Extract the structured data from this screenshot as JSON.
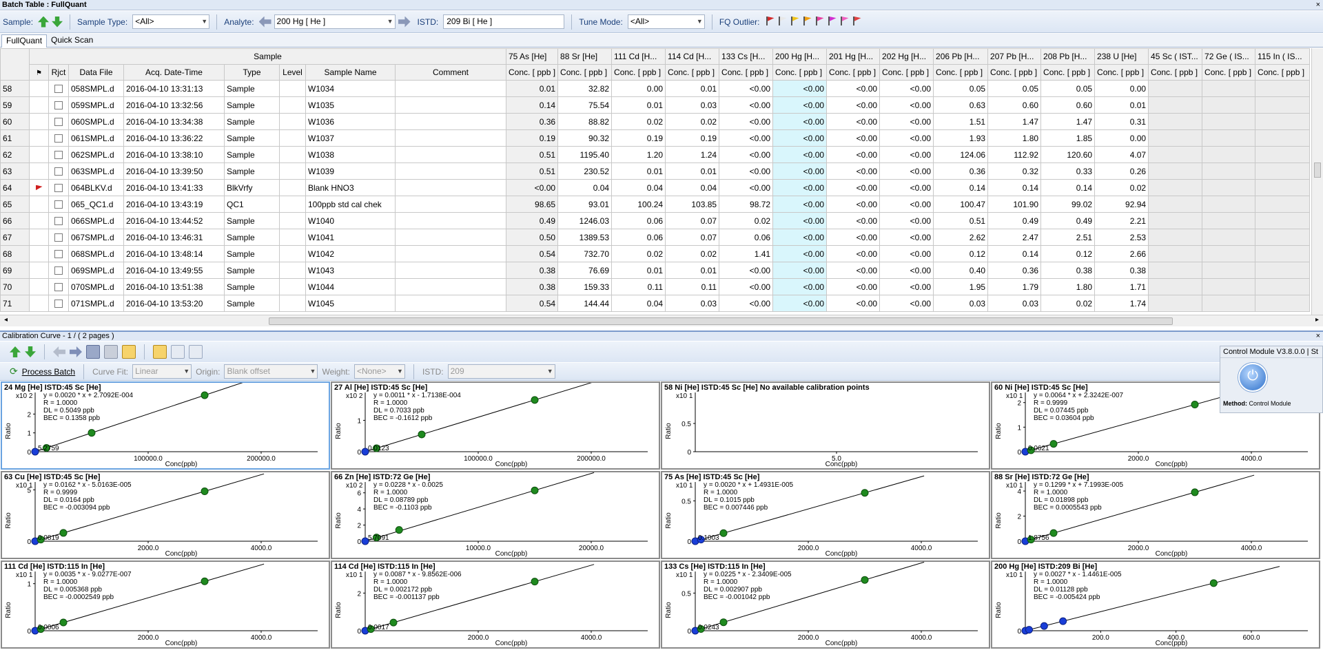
{
  "window": {
    "title": "Batch Table : FullQuant",
    "close": "×"
  },
  "toolbar": {
    "sample_label": "Sample:",
    "sample_type_label": "Sample Type:",
    "sample_type_value": "<All>",
    "analyte_label": "Analyte:",
    "analyte_value": "200  Hg  [ He ]",
    "istd_label": "ISTD:",
    "istd_value": "209  Bi  [ He ]",
    "tune_mode_label": "Tune Mode:",
    "tune_mode_value": "<All>",
    "fq_outlier_label": "FQ Outlier:",
    "flag_colors": [
      "#d42a2a",
      "#e8e8e8",
      "#f0c419",
      "#f0a010",
      "#e83fa0",
      "#d02fd0",
      "#f060c0",
      "#e04040"
    ]
  },
  "tabs": [
    "FullQuant",
    "Quick Scan"
  ],
  "grid": {
    "group_header": "Sample",
    "columns": [
      "",
      "Rjct",
      "Data File",
      "Acq. Date-Time",
      "Type",
      "Level",
      "Sample Name",
      "Comment"
    ],
    "analytes": [
      "75  As  [He]",
      "88  Sr  [He]",
      "111  Cd  [H...",
      "114  Cd  [H...",
      "133  Cs  [H...",
      "200  Hg  [H...",
      "201  Hg  [H...",
      "202  Hg  [H...",
      "206  Pb  [H...",
      "207  Pb  [H...",
      "208  Pb  [H...",
      "238  U  [He]",
      "45  Sc  ( IST...",
      "72  Ge  ( IS...",
      "115  In  ( IS..."
    ],
    "unit": "Conc. [ ppb ]",
    "rows": [
      {
        "n": "58",
        "flag": false,
        "file": "058SMPL.d",
        "dt": "2016-04-10 13:31:13",
        "type": "Sample",
        "level": "",
        "name": "W1034",
        "comment": "",
        "vals": [
          "0.01",
          "32.82",
          "0.00",
          "0.01",
          "<0.00",
          "<0.00",
          "<0.00",
          "<0.00",
          "0.05",
          "0.05",
          "0.05",
          "0.00",
          "",
          "",
          ""
        ]
      },
      {
        "n": "59",
        "flag": false,
        "file": "059SMPL.d",
        "dt": "2016-04-10 13:32:56",
        "type": "Sample",
        "level": "",
        "name": "W1035",
        "comment": "",
        "vals": [
          "0.14",
          "75.54",
          "0.01",
          "0.03",
          "<0.00",
          "<0.00",
          "<0.00",
          "<0.00",
          "0.63",
          "0.60",
          "0.60",
          "0.01",
          "",
          "",
          ""
        ]
      },
      {
        "n": "60",
        "flag": false,
        "file": "060SMPL.d",
        "dt": "2016-04-10 13:34:38",
        "type": "Sample",
        "level": "",
        "name": "W1036",
        "comment": "",
        "vals": [
          "0.36",
          "88.82",
          "0.02",
          "0.02",
          "<0.00",
          "<0.00",
          "<0.00",
          "<0.00",
          "1.51",
          "1.47",
          "1.47",
          "0.31",
          "",
          "",
          ""
        ]
      },
      {
        "n": "61",
        "flag": false,
        "file": "061SMPL.d",
        "dt": "2016-04-10 13:36:22",
        "type": "Sample",
        "level": "",
        "name": "W1037",
        "comment": "",
        "vals": [
          "0.19",
          "90.32",
          "0.19",
          "0.19",
          "<0.00",
          "<0.00",
          "<0.00",
          "<0.00",
          "1.93",
          "1.80",
          "1.85",
          "0.00",
          "",
          "",
          ""
        ]
      },
      {
        "n": "62",
        "flag": false,
        "file": "062SMPL.d",
        "dt": "2016-04-10 13:38:10",
        "type": "Sample",
        "level": "",
        "name": "W1038",
        "comment": "",
        "vals": [
          "0.51",
          "1195.40",
          "1.20",
          "1.24",
          "<0.00",
          "<0.00",
          "<0.00",
          "<0.00",
          "124.06",
          "112.92",
          "120.60",
          "4.07",
          "",
          "",
          ""
        ]
      },
      {
        "n": "63",
        "flag": false,
        "file": "063SMPL.d",
        "dt": "2016-04-10 13:39:50",
        "type": "Sample",
        "level": "",
        "name": "W1039",
        "comment": "",
        "vals": [
          "0.51",
          "230.52",
          "0.01",
          "0.01",
          "<0.00",
          "<0.00",
          "<0.00",
          "<0.00",
          "0.36",
          "0.32",
          "0.33",
          "0.26",
          "",
          "",
          ""
        ]
      },
      {
        "n": "64",
        "flag": true,
        "file": "064BLKV.d",
        "dt": "2016-04-10 13:41:33",
        "type": "BlkVrfy",
        "level": "",
        "name": "Blank HNO3",
        "comment": "",
        "vals": [
          "<0.00",
          "0.04",
          "0.04",
          "0.04",
          "<0.00",
          "<0.00",
          "<0.00",
          "<0.00",
          "0.14",
          "0.14",
          "0.14",
          "0.02",
          "",
          "",
          ""
        ]
      },
      {
        "n": "65",
        "flag": false,
        "file": "065_QC1.d",
        "dt": "2016-04-10 13:43:19",
        "type": "QC1",
        "level": "",
        "name": "100ppb std cal chek",
        "comment": "",
        "vals": [
          "98.65",
          "93.01",
          "100.24",
          "103.85",
          "98.72",
          "<0.00",
          "<0.00",
          "<0.00",
          "100.47",
          "101.90",
          "99.02",
          "92.94",
          "",
          "",
          ""
        ]
      },
      {
        "n": "66",
        "flag": false,
        "file": "066SMPL.d",
        "dt": "2016-04-10 13:44:52",
        "type": "Sample",
        "level": "",
        "name": "W1040",
        "comment": "",
        "vals": [
          "0.49",
          "1246.03",
          "0.06",
          "0.07",
          "0.02",
          "<0.00",
          "<0.00",
          "<0.00",
          "0.51",
          "0.49",
          "0.49",
          "2.21",
          "",
          "",
          ""
        ]
      },
      {
        "n": "67",
        "flag": false,
        "file": "067SMPL.d",
        "dt": "2016-04-10 13:46:31",
        "type": "Sample",
        "level": "",
        "name": "W1041",
        "comment": "",
        "vals": [
          "0.50",
          "1389.53",
          "0.06",
          "0.07",
          "0.06",
          "<0.00",
          "<0.00",
          "<0.00",
          "2.62",
          "2.47",
          "2.51",
          "2.53",
          "",
          "",
          ""
        ]
      },
      {
        "n": "68",
        "flag": false,
        "file": "068SMPL.d",
        "dt": "2016-04-10 13:48:14",
        "type": "Sample",
        "level": "",
        "name": "W1042",
        "comment": "",
        "vals": [
          "0.54",
          "732.70",
          "0.02",
          "0.02",
          "1.41",
          "<0.00",
          "<0.00",
          "<0.00",
          "0.12",
          "0.14",
          "0.12",
          "2.66",
          "",
          "",
          ""
        ]
      },
      {
        "n": "69",
        "flag": false,
        "file": "069SMPL.d",
        "dt": "2016-04-10 13:49:55",
        "type": "Sample",
        "level": "",
        "name": "W1043",
        "comment": "",
        "vals": [
          "0.38",
          "76.69",
          "0.01",
          "0.01",
          "<0.00",
          "<0.00",
          "<0.00",
          "<0.00",
          "0.40",
          "0.36",
          "0.38",
          "0.38",
          "",
          "",
          ""
        ]
      },
      {
        "n": "70",
        "flag": false,
        "file": "070SMPL.d",
        "dt": "2016-04-10 13:51:38",
        "type": "Sample",
        "level": "",
        "name": "W1044",
        "comment": "",
        "vals": [
          "0.38",
          "159.33",
          "0.11",
          "0.11",
          "<0.00",
          "<0.00",
          "<0.00",
          "<0.00",
          "1.95",
          "1.79",
          "1.80",
          "1.71",
          "",
          "",
          ""
        ]
      },
      {
        "n": "71",
        "flag": false,
        "file": "071SMPL.d",
        "dt": "2016-04-10 13:53:20",
        "type": "Sample",
        "level": "",
        "name": "W1045",
        "comment": "",
        "vals": [
          "0.54",
          "144.44",
          "0.04",
          "0.03",
          "<0.00",
          "<0.00",
          "<0.00",
          "<0.00",
          "0.03",
          "0.03",
          "0.02",
          "1.74",
          "",
          "",
          ""
        ]
      }
    ]
  },
  "calibration": {
    "header": "Calibration Curve -  1 / ( 2 pages )",
    "process_batch": "Process Batch",
    "curve_fit_label": "Curve Fit:",
    "curve_fit_value": "Linear",
    "origin_label": "Origin:",
    "origin_value": "Blank offset",
    "weight_label": "Weight:",
    "weight_value": "<None>",
    "istd_label": "ISTD:",
    "istd_value": "209",
    "xlabel": "Conc(ppb)",
    "ylabel": "Ratio"
  },
  "control_module": {
    "title": "Control Module V3.8.0.0 | St",
    "method_label": "Method:",
    "method_value": "Control Module"
  },
  "chart_data": [
    {
      "type": "scatter",
      "title": "24 Mg [He] ISTD:45 Sc [He]",
      "equation": "y = 0.0020 * x  + 2.7092E-004",
      "r": "R = 1.0000",
      "dl": "DL = 0.5049 ppb",
      "bec": "BEC = 0.1358 ppb",
      "yexp": "x10 2",
      "xticks": [
        "100000.0",
        "200000.0"
      ],
      "xmax": 250000,
      "ymax": 3,
      "yticks": [
        "0",
        "1",
        "2"
      ],
      "x": [
        0,
        10000,
        50000,
        150000
      ],
      "y": [
        0,
        0.2,
        1.0,
        3.0
      ],
      "low_label": "5.2759"
    },
    {
      "type": "scatter",
      "title": "27 Al [He] ISTD:45 Sc [He]",
      "equation": "y = 0.0011 * x  - 1.7138E-004",
      "r": "R = 1.0000",
      "dl": "DL = 0.7033 ppb",
      "bec": "BEC = -0.1612 ppb",
      "yexp": "x10 2",
      "xticks": [
        "100000.0",
        "200000.0"
      ],
      "xmax": 250000,
      "ymax": 1.8,
      "yticks": [
        "0",
        "1"
      ],
      "x": [
        0,
        10000,
        50000,
        150000
      ],
      "y": [
        0,
        0.11,
        0.55,
        1.65
      ],
      "low_label": "0.0123"
    },
    {
      "type": "scatter",
      "title": "58 Ni [He] ISTD:45 Sc [He] No available calibration points",
      "equation": "",
      "r": "",
      "dl": "",
      "bec": "",
      "yexp": "x10 1",
      "xticks": [
        "5.0"
      ],
      "xmax": 10,
      "ymax": 1,
      "yticks": [
        "0",
        "0.5"
      ],
      "x": [],
      "y": [],
      "low_label": ""
    },
    {
      "type": "scatter",
      "title": "60 Ni [He] ISTD:45 Sc [He]",
      "equation": "y = 0.0064 * x  + 2.3242E-007",
      "r": "R = 0.9999",
      "dl": "DL = 0.07445 ppb",
      "bec": "BEC = 0.03604 ppb",
      "yexp": "x10 1",
      "xticks": [
        "2000.0",
        "4000.0"
      ],
      "xmax": 5000,
      "ymax": 2.3,
      "yticks": [
        "0",
        "1",
        "2"
      ],
      "x": [
        0,
        100,
        500,
        3000
      ],
      "y": [
        0,
        0.06,
        0.32,
        1.92
      ],
      "low_label": "0.0621"
    },
    {
      "type": "scatter",
      "title": "63 Cu [He] ISTD:45 Sc [He]",
      "equation": "y = 0.0162 * x  - 5.0163E-005",
      "r": "R = 0.9999",
      "dl": "DL = 0.0164 ppb",
      "bec": "BEC = -0.003094 ppb",
      "yexp": "x10 1",
      "xticks": [
        "2000.0",
        "4000.0"
      ],
      "xmax": 5000,
      "ymax": 5.5,
      "yticks": [
        "0",
        "5"
      ],
      "x": [
        0,
        100,
        500,
        3000
      ],
      "y": [
        0,
        0.16,
        0.81,
        4.86
      ],
      "low_label": "0.0819"
    },
    {
      "type": "scatter",
      "title": "66 Zn [He] ISTD:72 Ge [He]",
      "equation": "y = 0.0228 * x  - 0.0025",
      "r": "R = 1.0000",
      "dl": "DL = 0.08789 ppb",
      "bec": "BEC = -0.1103 ppb",
      "yexp": "x10 2",
      "xticks": [
        "10000.0",
        "20000.0"
      ],
      "xmax": 25000,
      "ymax": 7,
      "yticks": [
        "0",
        "2",
        "4",
        "6"
      ],
      "x": [
        0,
        1000,
        3000,
        15000
      ],
      "y": [
        0,
        0.46,
        1.4,
        6.3
      ],
      "low_label": "5.7091"
    },
    {
      "type": "scatter",
      "title": "75 As [He] ISTD:45 Sc [He]",
      "equation": "y = 0.0020 * x  + 1.4931E-005",
      "r": "R = 1.0000",
      "dl": "DL = 0.1015 ppb",
      "bec": "BEC = 0.007446 ppb",
      "yexp": "x10 1",
      "xticks": [
        "2000.0",
        "4000.0"
      ],
      "xmax": 5000,
      "ymax": 0.7,
      "yticks": [
        "0",
        "0.5"
      ],
      "x": [
        0,
        100,
        500,
        3000
      ],
      "y": [
        0,
        0.02,
        0.1,
        0.6
      ],
      "low_label": "0.1003"
    },
    {
      "type": "scatter",
      "title": "88 Sr [He] ISTD:72 Ge [He]",
      "equation": "y = 0.1299 * x  + 7.1993E-005",
      "r": "R = 1.0000",
      "dl": "DL = 0.01898 ppb",
      "bec": "BEC = 0.0005543 ppb",
      "yexp": "x10 1",
      "xticks": [
        "2000.0",
        "4000.0"
      ],
      "xmax": 5000,
      "ymax": 4.5,
      "yticks": [
        "0",
        "2",
        "4"
      ],
      "x": [
        0,
        100,
        500,
        3000
      ],
      "y": [
        0,
        0.13,
        0.65,
        3.9
      ],
      "low_label": "1.8756"
    },
    {
      "type": "scatter",
      "title": "111 Cd [He] ISTD:115 In [He]",
      "equation": "y = 0.0035 * x  - 9.0277E-007",
      "r": "R = 1.0000",
      "dl": "DL = 0.005368 ppb",
      "bec": "BEC = -0.0002549 ppb",
      "yexp": "x10 1",
      "xticks": [
        "2000.0",
        "4000.0"
      ],
      "xmax": 5000,
      "ymax": 1.2,
      "yticks": [
        "0",
        "1"
      ],
      "x": [
        0,
        100,
        500,
        3000
      ],
      "y": [
        0,
        0.035,
        0.175,
        1.05
      ],
      "low_label": "0.0006"
    },
    {
      "type": "scatter",
      "title": "114 Cd [He] ISTD:115 In [He]",
      "equation": "y = 0.0087 * x  - 9.8562E-006",
      "r": "R = 1.0000",
      "dl": "DL = 0.002172 ppb",
      "bec": "BEC = -0.001137 ppb",
      "yexp": "x10 1",
      "xticks": [
        "2000.0",
        "4000.0"
      ],
      "xmax": 5000,
      "ymax": 3,
      "yticks": [
        "0",
        "2"
      ],
      "x": [
        0,
        100,
        500,
        3000
      ],
      "y": [
        0,
        0.087,
        0.435,
        2.61
      ],
      "low_label": "0.0017"
    },
    {
      "type": "scatter",
      "title": "133 Cs [He] ISTD:115 In [He]",
      "equation": "y = 0.0225 * x  - 2.3409E-005",
      "r": "R = 1.0000",
      "dl": "DL = 0.002907 ppb",
      "bec": "BEC = -0.001042 ppb",
      "yexp": "x10 1",
      "xticks": [
        "2000.0",
        "4000.0"
      ],
      "xmax": 5000,
      "ymax": 0.75,
      "yticks": [
        "0",
        "0.5"
      ],
      "x": [
        0,
        100,
        500,
        3000
      ],
      "y": [
        0,
        0.0225,
        0.1125,
        0.675
      ],
      "low_label": "0.0243"
    },
    {
      "type": "scatter",
      "title": "200 Hg [He] ISTD:209 Bi [He]",
      "equation": "y = 0.0027 * x  - 1.4461E-005",
      "r": "R = 1.0000",
      "dl": "DL = 0.01128 ppb",
      "bec": "BEC = -0.005424 ppb",
      "yexp": "x10 1",
      "xticks": [
        "200.0",
        "400.0",
        "600.0"
      ],
      "xmax": 750,
      "ymax": 0.16,
      "yticks": [
        "0"
      ],
      "x": [
        0,
        10,
        50,
        100,
        500
      ],
      "y": [
        0,
        0.0027,
        0.0135,
        0.027,
        0.135
      ],
      "low_label": ""
    }
  ]
}
